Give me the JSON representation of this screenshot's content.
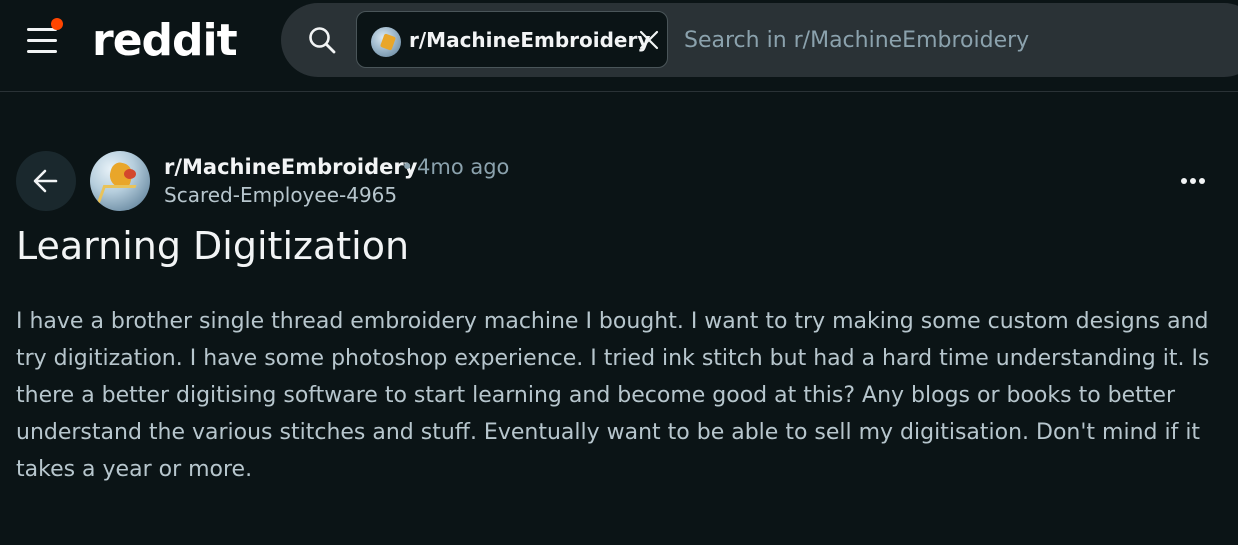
{
  "header": {
    "logo_text": "reddit",
    "search": {
      "community_chip": "r/MachineEmbroidery",
      "placeholder": "Search in r/MachineEmbroidery"
    }
  },
  "post": {
    "subreddit": "r/MachineEmbroidery",
    "separator": "•",
    "time_ago": "4mo ago",
    "author": "Scared-Employee-4965",
    "title": "Learning Digitization",
    "body": "I have a brother single thread embroidery machine I bought. I want to try making some custom designs and try digitization. I have some photoshop experience. I tried ink stitch but had a hard time understanding it. Is there a better digitising software to start learning and become good at this? Any blogs or books to better understand the various stitches and stuff. Eventually want to be able to sell my digitisation. Don't mind if it takes a year or more."
  },
  "icons": {
    "menu": "hamburger-menu-icon",
    "notification": "notification-dot-icon",
    "search": "search-icon",
    "close": "close-icon",
    "back": "arrow-left-icon",
    "more": "more-horizontal-icon"
  },
  "colors": {
    "background": "#0b1416",
    "search_bg": "#2a3236",
    "accent": "#ff4500",
    "text_primary": "#f2f4f5",
    "text_secondary": "#8ba2ad",
    "body_text": "#b7c6cd"
  }
}
